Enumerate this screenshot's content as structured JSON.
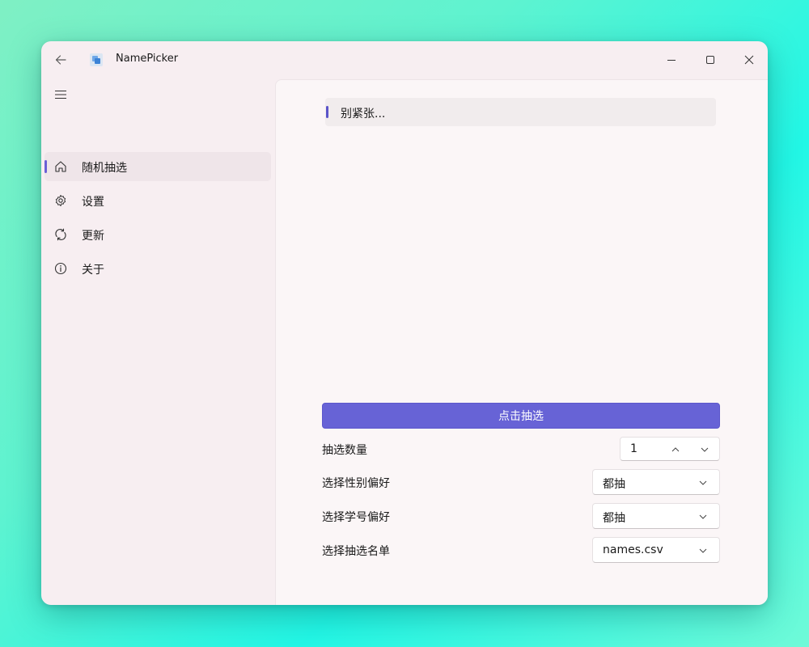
{
  "window": {
    "title": "NamePicker",
    "icons": {
      "back": "back-arrow-icon",
      "app": "app-logo-icon",
      "minimize": "minimize-icon",
      "maximize": "maximize-icon",
      "close": "close-icon"
    }
  },
  "nav": {
    "menu_icon": "hamburger-menu-icon",
    "items": [
      {
        "label": "随机抽选",
        "icon": "home-icon",
        "selected": true
      },
      {
        "label": "设置",
        "icon": "gear-icon",
        "selected": false
      },
      {
        "label": "更新",
        "icon": "sync-icon",
        "selected": false
      },
      {
        "label": "关于",
        "icon": "info-icon",
        "selected": false
      }
    ]
  },
  "main": {
    "info_text": "别紧张...",
    "pick_button": "点击抽选",
    "count": {
      "label": "抽选数量",
      "value": "1"
    },
    "gender_pref": {
      "label": "选择性别偏好",
      "value": "都抽"
    },
    "number_pref": {
      "label": "选择学号偏好",
      "value": "都抽"
    },
    "name_list": {
      "label": "选择抽选名单",
      "value": "names.csv"
    }
  },
  "colors": {
    "accent": "#6763d6",
    "window_bg": "#f7eef1",
    "content_bg": "#fbf6f7"
  }
}
